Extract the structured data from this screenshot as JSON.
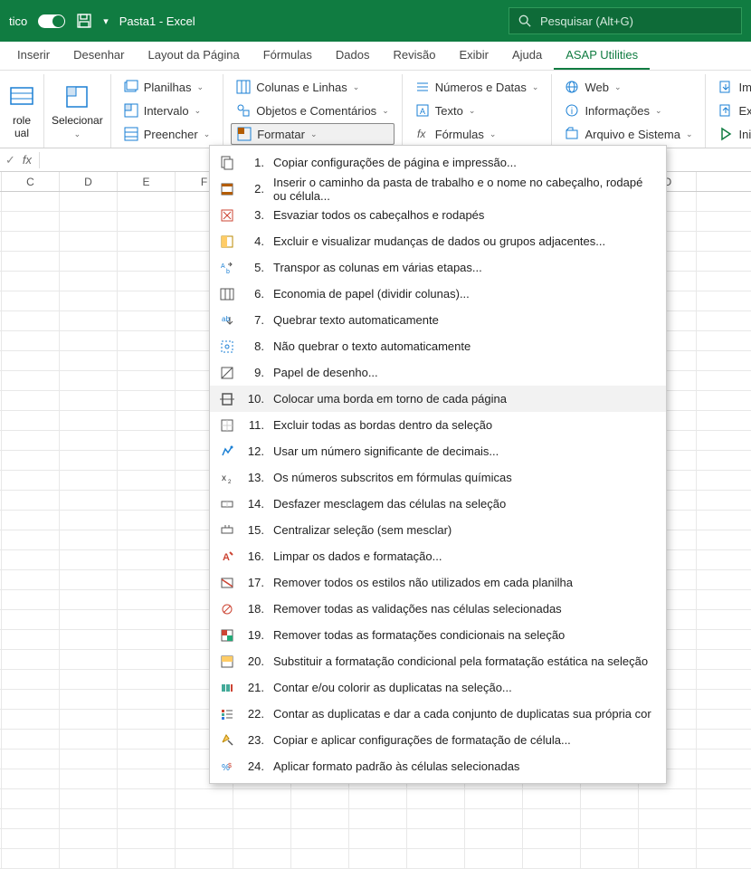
{
  "titlebar": {
    "auto_label": "tico",
    "doc_name": "Pasta1  -  Excel",
    "search_placeholder": "Pesquisar (Alt+G)"
  },
  "tabs": [
    {
      "label": "Inserir"
    },
    {
      "label": "Desenhar"
    },
    {
      "label": "Layout da Página"
    },
    {
      "label": "Fórmulas"
    },
    {
      "label": "Dados"
    },
    {
      "label": "Revisão"
    },
    {
      "label": "Exibir"
    },
    {
      "label": "Ajuda"
    },
    {
      "label": "ASAP Utilities",
      "active": true
    }
  ],
  "ribbon": {
    "big": [
      {
        "label1": "role",
        "label2": "ual"
      },
      {
        "label1": "Selecionar"
      }
    ],
    "group1": [
      {
        "label": "Planilhas"
      },
      {
        "label": "Intervalo"
      },
      {
        "label": "Preencher"
      }
    ],
    "group2": [
      {
        "label": "Colunas e Linhas"
      },
      {
        "label": "Objetos e Comentários"
      },
      {
        "label": "Formatar",
        "selected": true
      }
    ],
    "group3": [
      {
        "label": "Números e Datas"
      },
      {
        "label": "Texto"
      },
      {
        "label": "Fórmulas"
      }
    ],
    "group4": [
      {
        "label": "Web"
      },
      {
        "label": "Informações"
      },
      {
        "label": "Arquivo e Sistema"
      }
    ],
    "group5": [
      {
        "label": "Importar"
      },
      {
        "label": "Exportar"
      },
      {
        "label": "Iniciar"
      }
    ]
  },
  "columns": [
    "C",
    "D",
    "E",
    "F",
    "",
    "",
    "",
    "",
    "",
    "",
    "",
    "O"
  ],
  "menu": [
    {
      "n": "1.",
      "text": "Copiar configurações de página e impressão..."
    },
    {
      "n": "2.",
      "text": "Inserir o caminho da pasta de trabalho e o nome no cabeçalho, rodapé ou célula..."
    },
    {
      "n": "3.",
      "text": "Esvaziar todos os cabeçalhos e rodapés"
    },
    {
      "n": "4.",
      "text": "Excluir e visualizar mudanças de dados ou grupos adjacentes..."
    },
    {
      "n": "5.",
      "text": "Transpor as colunas em várias etapas..."
    },
    {
      "n": "6.",
      "text": "Economia de papel (dividir colunas)..."
    },
    {
      "n": "7.",
      "text": "Quebrar texto automaticamente"
    },
    {
      "n": "8.",
      "text": "Não quebrar o texto automaticamente"
    },
    {
      "n": "9.",
      "text": "Papel de desenho..."
    },
    {
      "n": "10.",
      "text": "Colocar uma borda em torno de cada página",
      "highlighted": true
    },
    {
      "n": "11.",
      "text": "Excluir todas as bordas dentro da seleção"
    },
    {
      "n": "12.",
      "text": "Usar um número significante de decimais..."
    },
    {
      "n": "13.",
      "text": "Os números subscritos em fórmulas químicas"
    },
    {
      "n": "14.",
      "text": "Desfazer mesclagem das células na seleção"
    },
    {
      "n": "15.",
      "text": "Centralizar seleção (sem mesclar)"
    },
    {
      "n": "16.",
      "text": "Limpar os dados e formatação..."
    },
    {
      "n": "17.",
      "text": "Remover todos os estilos não utilizados em cada planilha"
    },
    {
      "n": "18.",
      "text": "Remover todas as validações nas células selecionadas"
    },
    {
      "n": "19.",
      "text": "Remover todas as formatações condicionais na seleção"
    },
    {
      "n": "20.",
      "text": "Substituir a formatação condicional pela formatação estática na seleção"
    },
    {
      "n": "21.",
      "text": "Contar e/ou colorir as duplicatas na seleção..."
    },
    {
      "n": "22.",
      "text": "Contar as duplicatas e dar a cada conjunto de duplicatas sua própria cor"
    },
    {
      "n": "23.",
      "text": "Copiar e aplicar configurações de formatação de célula..."
    },
    {
      "n": "24.",
      "text": "Aplicar formato padrão às células selecionadas"
    }
  ]
}
